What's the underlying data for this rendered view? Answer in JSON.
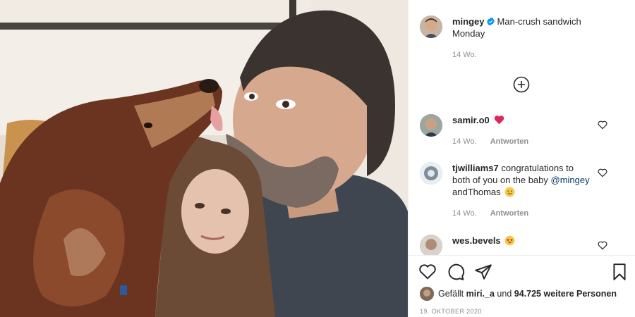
{
  "post": {
    "author": "mingey",
    "caption": "Man-crush sandwich Monday",
    "age": "14 Wo."
  },
  "comments": [
    {
      "user": "samir.o0",
      "text": "",
      "emoji": "red-heart",
      "age": "14 Wo.",
      "reply_label": "Antworten"
    },
    {
      "user": "tjwilliams7",
      "text_before": "congratulations to both of you on the baby",
      "mention": "@mingey",
      "text_after": "andThomas",
      "emoji": "smiley",
      "age": "14 Wo.",
      "reply_label": "Antworten"
    },
    {
      "user": "wes.bevels",
      "emoji": "star-struck"
    }
  ],
  "likes": {
    "prefix": "Gefällt",
    "first_liker": "miri._a",
    "joiner": "und",
    "count_text": "94.725 weitere Personen"
  },
  "date": "19. OKTOBER 2020",
  "icons": [
    "verified-badge-icon",
    "plus-circle-icon",
    "heart-icon",
    "comment-icon",
    "share-icon",
    "bookmark-icon"
  ],
  "colors": {
    "verified": "#0095f6",
    "heart": "#ed4956",
    "mention": "#00376b",
    "muted": "#8e8e8e"
  }
}
